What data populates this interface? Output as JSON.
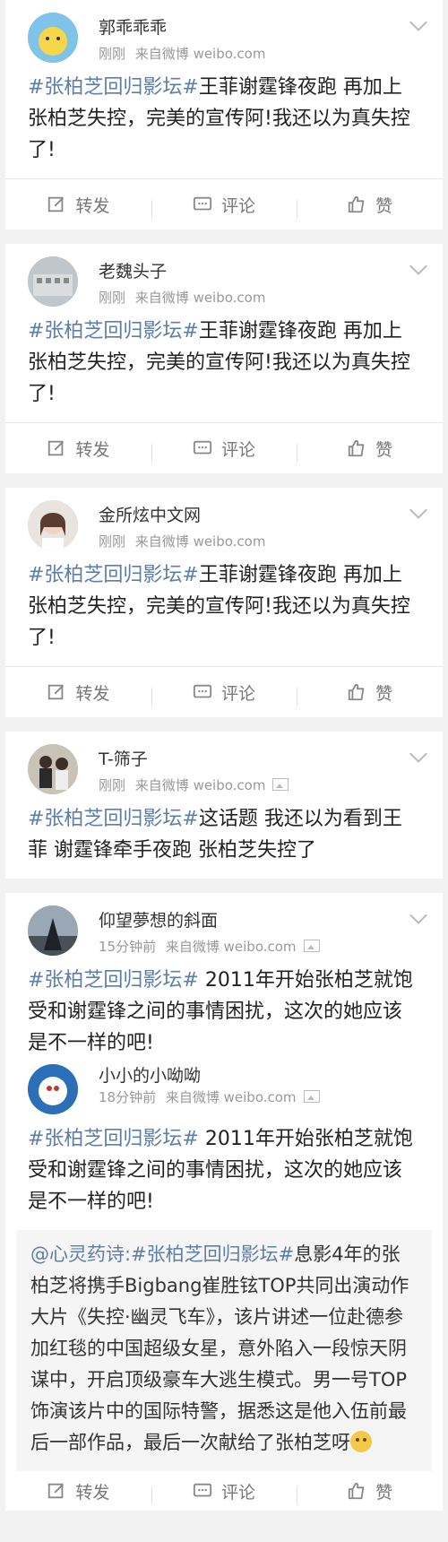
{
  "posts": [
    {
      "username": "郭乖乖乖",
      "time": "刚刚",
      "source": "来自微博 weibo.com",
      "tag": "#张柏芝回归影坛#",
      "text": "王菲谢霆锋夜跑 再加上张柏芝失控，完美的宣传阿!我还以为真失控了!",
      "has_image_icon": false
    },
    {
      "username": "老魏头子",
      "time": "刚刚",
      "source": "来自微博 weibo.com",
      "tag": "#张柏芝回归影坛#",
      "text": "王菲谢霆锋夜跑 再加上张柏芝失控，完美的宣传阿!我还以为真失控了!",
      "has_image_icon": false
    },
    {
      "username": "金所炫中文网",
      "time": "刚刚",
      "source": "来自微博 weibo.com",
      "tag": "#张柏芝回归影坛#",
      "text": "王菲谢霆锋夜跑 再加上张柏芝失控，完美的宣传阿!我还以为真失控了!",
      "has_image_icon": false
    },
    {
      "username": "T-筛子",
      "time": "刚刚",
      "source": "来自微博 weibo.com",
      "tag": "#张柏芝回归影坛#",
      "text": "这话题 我还以为看到王菲 谢霆锋牵手夜跑 张柏芝失控了",
      "has_image_icon": true
    },
    {
      "username": "仰望夢想的斜面",
      "time": "15分钟前",
      "source": "来自微博 weibo.com",
      "tag": "#张柏芝回归影坛#",
      "text": " 2011年开始张柏芝就饱受和谢霆锋之间的事情困扰，这次的她应该是不一样的吧!",
      "has_image_icon": true
    },
    {
      "username": "小小的小呦呦",
      "time": "18分钟前",
      "source": "来自微博 weibo.com",
      "tag": "#张柏芝回归影坛#",
      "text": " 2011年开始张柏芝就饱受和谢霆锋之间的事情困扰，这次的她应该是不一样的吧!",
      "has_image_icon": true
    }
  ],
  "repost": {
    "prefix": "@心灵药诗:",
    "tag": "#张柏芝回归影坛#",
    "text": "息影4年的张柏芝将携手Bigbang崔胜铉TOP共同出演动作大片《失控·幽灵飞车》，该片讲述一位赴德参加红毯的中国超级女星，意外陷入一段惊天阴谋中，开启顶级豪车大逃生模式。男一号TOP饰演该片中的国际特警，据悉这是他入伍前最后一部作品，最后一次献给了张柏芝呀"
  },
  "actions": {
    "repost": "转发",
    "comment": "评论",
    "like": "赞"
  },
  "icons": {
    "repost": "edit-icon",
    "comment": "comment-icon",
    "like": "thumbs-up-icon",
    "menu": "chevron-down-icon",
    "emoji": "emoji-icon",
    "image": "image-icon"
  },
  "colors": {
    "tag": "#5d7ea6",
    "meta": "#999999",
    "background": "#f2f2f2"
  }
}
